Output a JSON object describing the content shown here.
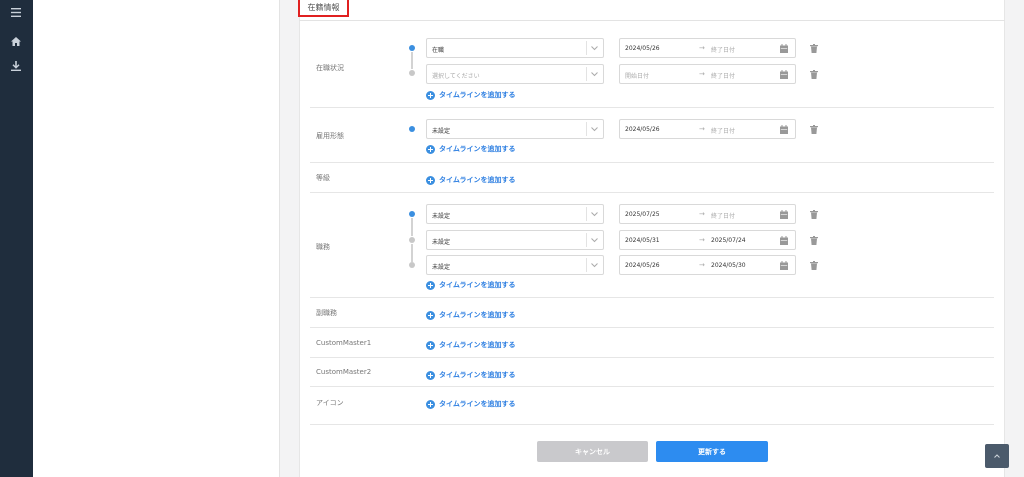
{
  "section": {
    "title": "在籍情報"
  },
  "timeline": {
    "add_label": "タイムラインを追加する",
    "end_placeholder": "終了日付",
    "start_placeholder": "開始日付",
    "select_placeholder": "選択してください",
    "arrow": "→"
  },
  "rows": {
    "status": {
      "label": "在職状況",
      "entries": [
        {
          "value": "在職",
          "start": "2024/05/26"
        },
        {
          "value": "選択してください"
        }
      ]
    },
    "employment": {
      "label": "雇用形態",
      "entries": [
        {
          "value": "未設定",
          "start": "2024/05/26"
        }
      ]
    },
    "grade": {
      "label": "等級"
    },
    "position": {
      "label": "職務",
      "entries": [
        {
          "value": "未設定",
          "start": "2025/07/25"
        },
        {
          "value": "未設定",
          "start": "2024/05/31",
          "end": "2025/07/24"
        },
        {
          "value": "未設定",
          "start": "2024/05/26",
          "end": "2024/05/30"
        }
      ]
    },
    "sub_position": {
      "label": "副職務"
    },
    "custom1": {
      "label": "CustomMaster1"
    },
    "custom2": {
      "label": "CustomMaster2"
    },
    "icon": {
      "label": "アイコン"
    }
  },
  "buttons": {
    "cancel": "キャンセル",
    "update": "更新する"
  },
  "icons": {
    "menu": "menu-icon",
    "home": "home-icon",
    "download": "download-icon",
    "trash": "trash-icon",
    "calendar": "calendar-icon",
    "chevron": "chevron-down-icon",
    "add": "plus-circle-icon",
    "scroll_top": "chevron-up-icon"
  },
  "colors": {
    "accent": "#2d8cf0",
    "sidebar": "#1f2d3d",
    "highlight": "#e02020",
    "disabled": "#c9c9cc"
  }
}
